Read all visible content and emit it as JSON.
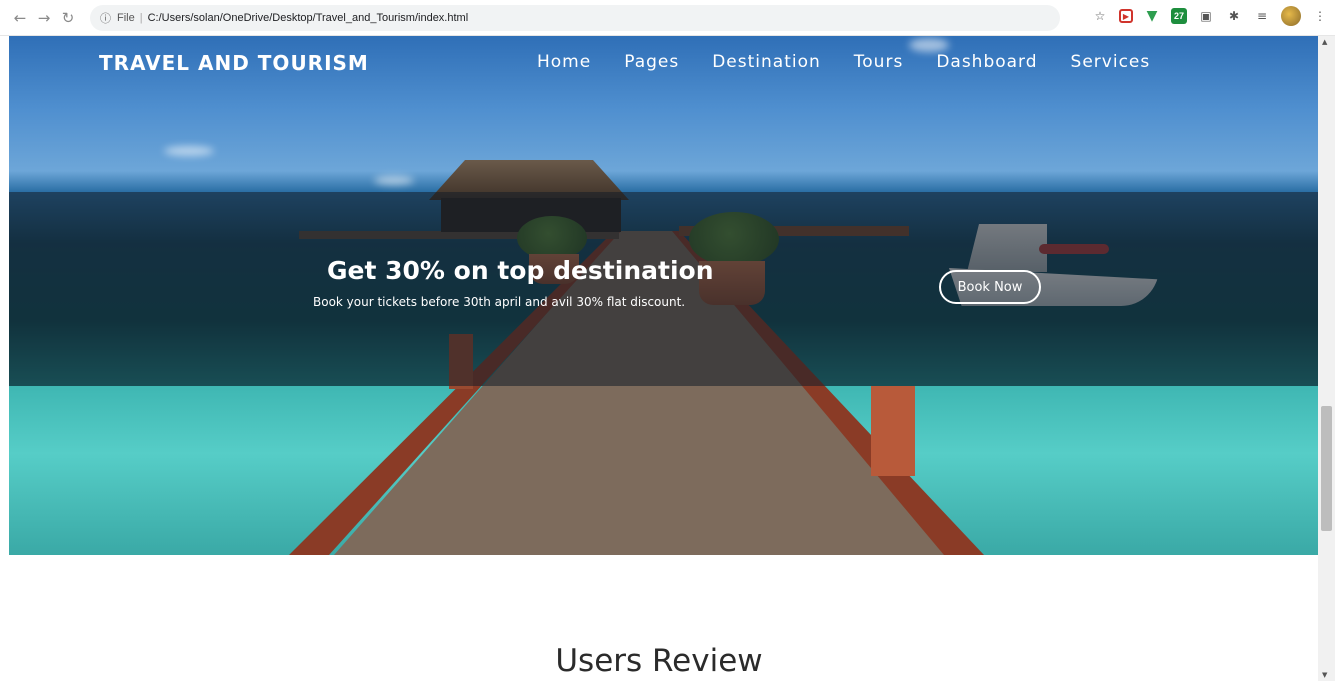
{
  "browser": {
    "url_prefix": "File",
    "url": "C:/Users/solan/OneDrive/Desktop/Travel_and_Tourism/index.html",
    "extensions": [
      "bookmark-star-icon",
      "youtube-icon",
      "shield-icon",
      "calendar-icon",
      "camera-icon",
      "puzzle-icon",
      "reading-list-icon",
      "profile-avatar",
      "menu-dots-icon"
    ],
    "calendar_badge": "27"
  },
  "header": {
    "brand": "TRAVEL AND TOURISM",
    "menu": [
      "Home",
      "Pages",
      "Destination",
      "Tours",
      "Dashboard",
      "Services"
    ]
  },
  "promo": {
    "title": "Get 30% on top destination",
    "subtitle": "Book your tickets before 30th april and avil 30% flat discount.",
    "cta": "Book Now"
  },
  "reviews": {
    "title": "Users Review"
  }
}
